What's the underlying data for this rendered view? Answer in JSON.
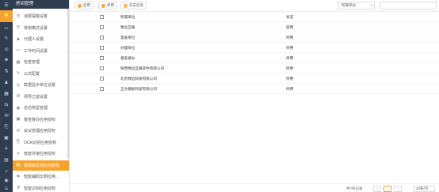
{
  "sidebar": {
    "title": "房间管理",
    "items": [
      {
        "icon": "☰",
        "label": "消费提醒设置"
      },
      {
        "icon": "☰",
        "label": "常用格式设置"
      },
      {
        "icon": "♟",
        "label": "代理人设置"
      },
      {
        "icon": "▭",
        "label": "工作时间设置"
      },
      {
        "icon": "▦",
        "label": "检查管理"
      },
      {
        "icon": "✎",
        "label": "公式配置"
      },
      {
        "icon": "◎",
        "label": "数据显示单位设置"
      },
      {
        "icon": "⚙",
        "label": "领导之窗设置"
      },
      {
        "icon": "◉",
        "label": "信访类型管理"
      },
      {
        "icon": "▣",
        "label": "督查督办应用授权"
      },
      {
        "icon": "✉",
        "label": "会议管理应用授权"
      },
      {
        "icon": "⎘",
        "label": "OCR识别应用授权"
      },
      {
        "icon": "⚘",
        "label": "智能外链应用授权"
      },
      {
        "icon": "▤",
        "label": "数据收发通应用授权"
      },
      {
        "icon": "⚑",
        "label": "智能辅助出预应用..."
      },
      {
        "icon": "⚗",
        "label": "智能识别应用授权"
      }
    ],
    "active_index": 13
  },
  "rail": {
    "icons": [
      "☰",
      "⚙",
      "▭",
      "✎",
      "◎",
      "⚑",
      "⚗",
      "♟",
      "▦",
      "⇆",
      "✉",
      "⎘",
      "▣",
      "⚘",
      "▤",
      "☼",
      "◉",
      "♙"
    ],
    "active_index": 1
  },
  "toolbar": {
    "buttons": [
      {
        "icon": "+",
        "label": "启用"
      },
      {
        "icon": "–",
        "label": "停用"
      },
      {
        "icon": "⟳",
        "label": "日志信息"
      }
    ],
    "filter_label": "所属单位",
    "filter_chevron": "▾",
    "search_placeholder": ""
  },
  "table": {
    "columns": [
      "所属单位",
      "状态"
    ],
    "rows": [
      {
        "unit": "致远互联",
        "state": "启用"
      },
      {
        "unit": "督查单位",
        "state": "停用"
      },
      {
        "unit": "办理单位",
        "state": "停用"
      },
      {
        "unit": "督查督办",
        "state": "停用"
      },
      {
        "unit": "陕西致远互联软件有限公司",
        "state": "停用"
      },
      {
        "unit": "北京致远科技有限公司",
        "state": "停用"
      },
      {
        "unit": "正文模板科技有限公司",
        "state": "停用"
      }
    ]
  },
  "pager": {
    "total_text": "共7条记录",
    "prev": "‹",
    "current_page": "1",
    "next": "›",
    "page_size": "20条/页"
  },
  "colors": {
    "accent": "#f7a32b",
    "nav_dark": "#2f3d51"
  }
}
